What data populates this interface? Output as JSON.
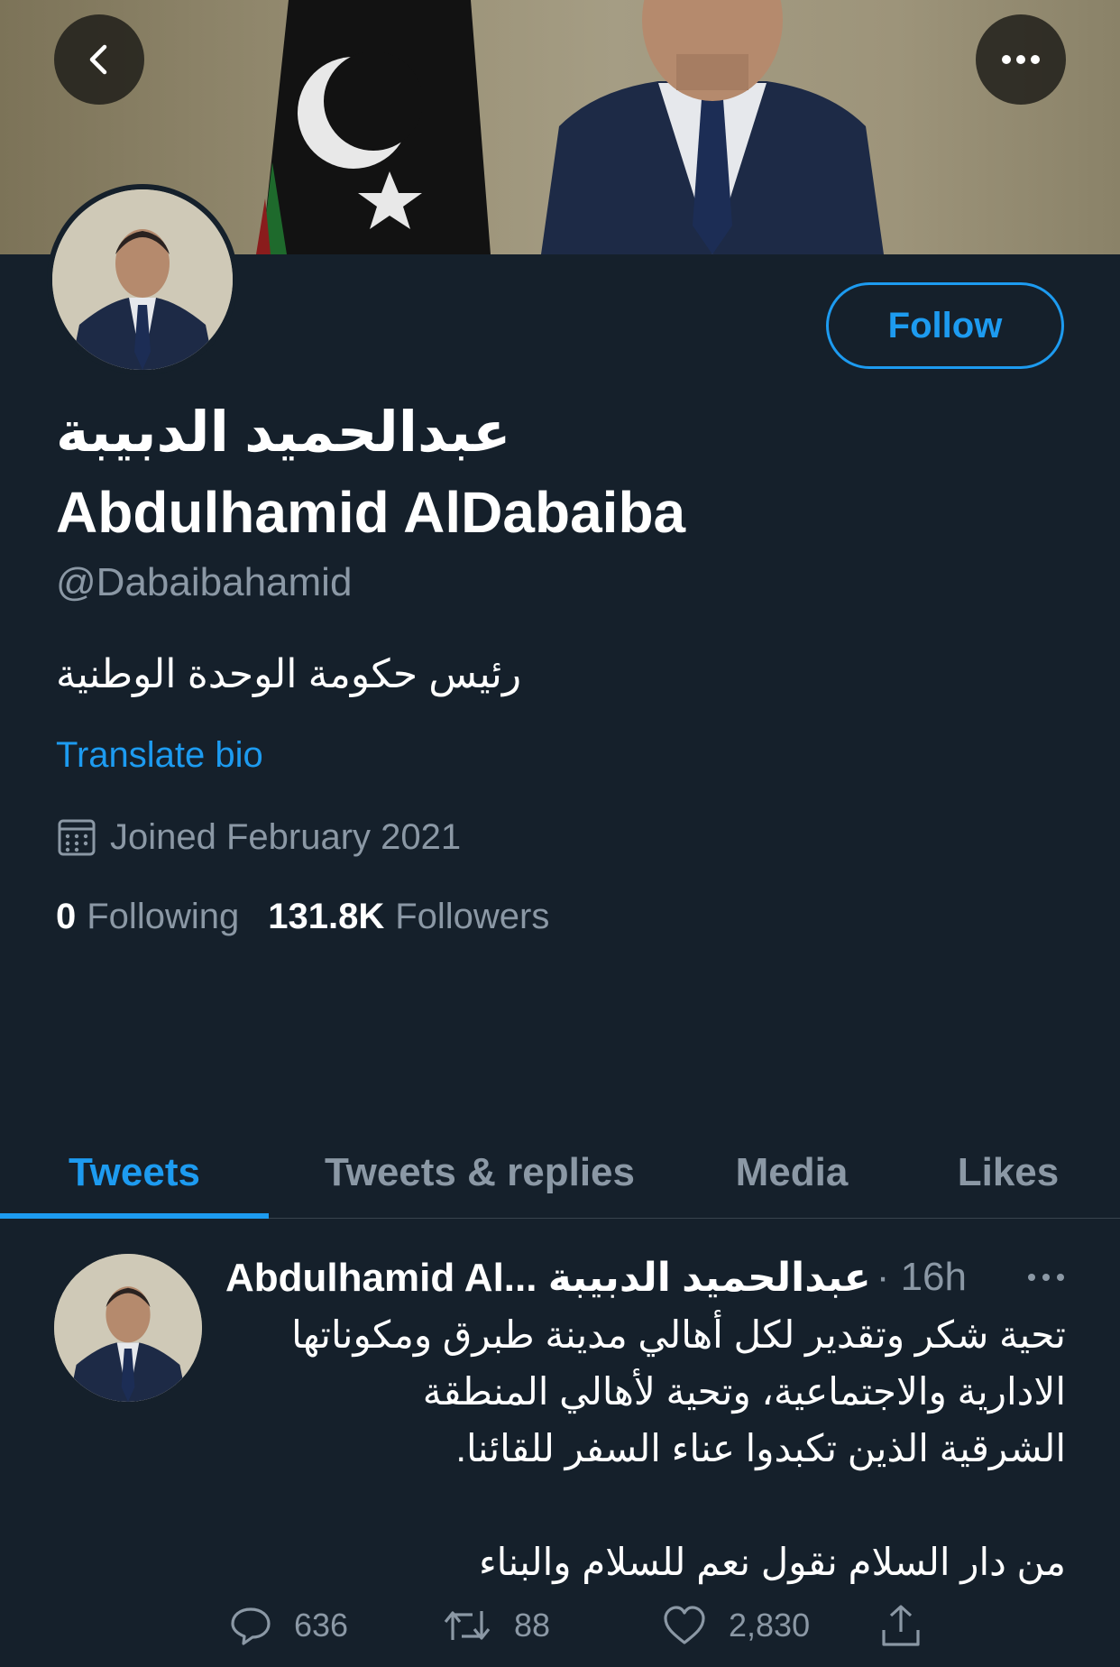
{
  "header": {
    "back_icon": "chevron-left-icon",
    "more_icon": "more-horizontal-icon"
  },
  "profile": {
    "name_ar": "عبدالحميد الدبيبة",
    "name_en": "Abdulhamid AlDabaiba",
    "handle": "@Dabaibahamid",
    "bio": "رئيس حكومة الوحدة الوطنية",
    "translate_label": "Translate bio",
    "joined": "Joined February 2021",
    "follow_label": "Follow",
    "following_count": "0",
    "following_label": "Following",
    "followers_count": "131.8K",
    "followers_label": "Followers"
  },
  "tabs": [
    {
      "label": "Tweets",
      "active": true
    },
    {
      "label": "Tweets & replies",
      "active": false
    },
    {
      "label": "Media",
      "active": false
    },
    {
      "label": "Likes",
      "active": false
    }
  ],
  "tweet": {
    "author": "Abdulhamid Al... عبدالحميد الدبيبة",
    "time": "· 16h",
    "body": "تحية شكر وتقدير لكل أهالي مدينة طبرق ومكوناتها\nالادارية والاجتماعية، وتحية لأهالي المنطقة\nالشرقية الذين تكبدوا عناء السفر للقائنا.\n\nمن دار السلام نقول نعم للسلام والبناء",
    "replies": "636",
    "retweets": "88",
    "likes": "2,830"
  },
  "colors": {
    "background": "#15202b",
    "accent": "#1d9bf0",
    "secondary_text": "#8b98a5",
    "divider": "#38444d"
  }
}
